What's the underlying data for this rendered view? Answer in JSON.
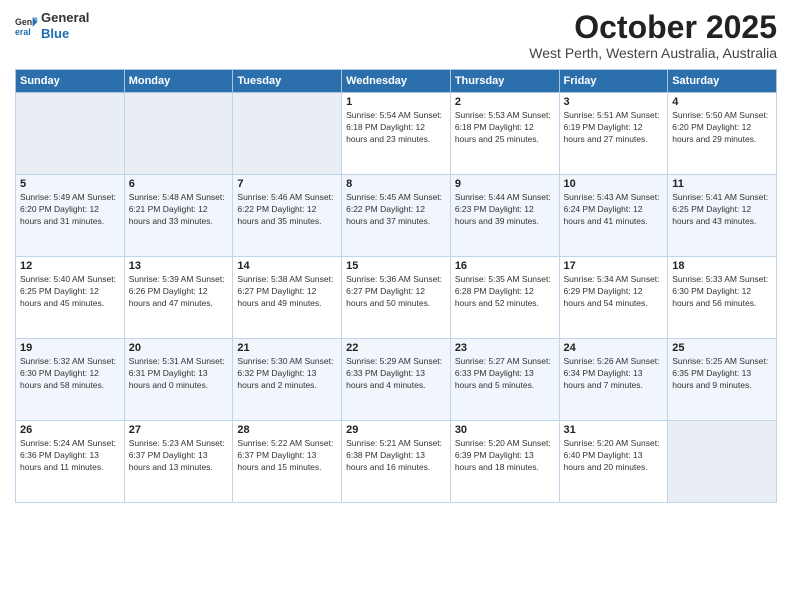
{
  "logo": {
    "general": "General",
    "blue": "Blue"
  },
  "title": "October 2025",
  "location": "West Perth, Western Australia, Australia",
  "weekdays": [
    "Sunday",
    "Monday",
    "Tuesday",
    "Wednesday",
    "Thursday",
    "Friday",
    "Saturday"
  ],
  "weeks": [
    [
      {
        "day": "",
        "info": ""
      },
      {
        "day": "",
        "info": ""
      },
      {
        "day": "",
        "info": ""
      },
      {
        "day": "1",
        "info": "Sunrise: 5:54 AM\nSunset: 6:18 PM\nDaylight: 12 hours\nand 23 minutes."
      },
      {
        "day": "2",
        "info": "Sunrise: 5:53 AM\nSunset: 6:18 PM\nDaylight: 12 hours\nand 25 minutes."
      },
      {
        "day": "3",
        "info": "Sunrise: 5:51 AM\nSunset: 6:19 PM\nDaylight: 12 hours\nand 27 minutes."
      },
      {
        "day": "4",
        "info": "Sunrise: 5:50 AM\nSunset: 6:20 PM\nDaylight: 12 hours\nand 29 minutes."
      }
    ],
    [
      {
        "day": "5",
        "info": "Sunrise: 5:49 AM\nSunset: 6:20 PM\nDaylight: 12 hours\nand 31 minutes."
      },
      {
        "day": "6",
        "info": "Sunrise: 5:48 AM\nSunset: 6:21 PM\nDaylight: 12 hours\nand 33 minutes."
      },
      {
        "day": "7",
        "info": "Sunrise: 5:46 AM\nSunset: 6:22 PM\nDaylight: 12 hours\nand 35 minutes."
      },
      {
        "day": "8",
        "info": "Sunrise: 5:45 AM\nSunset: 6:22 PM\nDaylight: 12 hours\nand 37 minutes."
      },
      {
        "day": "9",
        "info": "Sunrise: 5:44 AM\nSunset: 6:23 PM\nDaylight: 12 hours\nand 39 minutes."
      },
      {
        "day": "10",
        "info": "Sunrise: 5:43 AM\nSunset: 6:24 PM\nDaylight: 12 hours\nand 41 minutes."
      },
      {
        "day": "11",
        "info": "Sunrise: 5:41 AM\nSunset: 6:25 PM\nDaylight: 12 hours\nand 43 minutes."
      }
    ],
    [
      {
        "day": "12",
        "info": "Sunrise: 5:40 AM\nSunset: 6:25 PM\nDaylight: 12 hours\nand 45 minutes."
      },
      {
        "day": "13",
        "info": "Sunrise: 5:39 AM\nSunset: 6:26 PM\nDaylight: 12 hours\nand 47 minutes."
      },
      {
        "day": "14",
        "info": "Sunrise: 5:38 AM\nSunset: 6:27 PM\nDaylight: 12 hours\nand 49 minutes."
      },
      {
        "day": "15",
        "info": "Sunrise: 5:36 AM\nSunset: 6:27 PM\nDaylight: 12 hours\nand 50 minutes."
      },
      {
        "day": "16",
        "info": "Sunrise: 5:35 AM\nSunset: 6:28 PM\nDaylight: 12 hours\nand 52 minutes."
      },
      {
        "day": "17",
        "info": "Sunrise: 5:34 AM\nSunset: 6:29 PM\nDaylight: 12 hours\nand 54 minutes."
      },
      {
        "day": "18",
        "info": "Sunrise: 5:33 AM\nSunset: 6:30 PM\nDaylight: 12 hours\nand 56 minutes."
      }
    ],
    [
      {
        "day": "19",
        "info": "Sunrise: 5:32 AM\nSunset: 6:30 PM\nDaylight: 12 hours\nand 58 minutes."
      },
      {
        "day": "20",
        "info": "Sunrise: 5:31 AM\nSunset: 6:31 PM\nDaylight: 13 hours\nand 0 minutes."
      },
      {
        "day": "21",
        "info": "Sunrise: 5:30 AM\nSunset: 6:32 PM\nDaylight: 13 hours\nand 2 minutes."
      },
      {
        "day": "22",
        "info": "Sunrise: 5:29 AM\nSunset: 6:33 PM\nDaylight: 13 hours\nand 4 minutes."
      },
      {
        "day": "23",
        "info": "Sunrise: 5:27 AM\nSunset: 6:33 PM\nDaylight: 13 hours\nand 5 minutes."
      },
      {
        "day": "24",
        "info": "Sunrise: 5:26 AM\nSunset: 6:34 PM\nDaylight: 13 hours\nand 7 minutes."
      },
      {
        "day": "25",
        "info": "Sunrise: 5:25 AM\nSunset: 6:35 PM\nDaylight: 13 hours\nand 9 minutes."
      }
    ],
    [
      {
        "day": "26",
        "info": "Sunrise: 5:24 AM\nSunset: 6:36 PM\nDaylight: 13 hours\nand 11 minutes."
      },
      {
        "day": "27",
        "info": "Sunrise: 5:23 AM\nSunset: 6:37 PM\nDaylight: 13 hours\nand 13 minutes."
      },
      {
        "day": "28",
        "info": "Sunrise: 5:22 AM\nSunset: 6:37 PM\nDaylight: 13 hours\nand 15 minutes."
      },
      {
        "day": "29",
        "info": "Sunrise: 5:21 AM\nSunset: 6:38 PM\nDaylight: 13 hours\nand 16 minutes."
      },
      {
        "day": "30",
        "info": "Sunrise: 5:20 AM\nSunset: 6:39 PM\nDaylight: 13 hours\nand 18 minutes."
      },
      {
        "day": "31",
        "info": "Sunrise: 5:20 AM\nSunset: 6:40 PM\nDaylight: 13 hours\nand 20 minutes."
      },
      {
        "day": "",
        "info": ""
      }
    ]
  ]
}
